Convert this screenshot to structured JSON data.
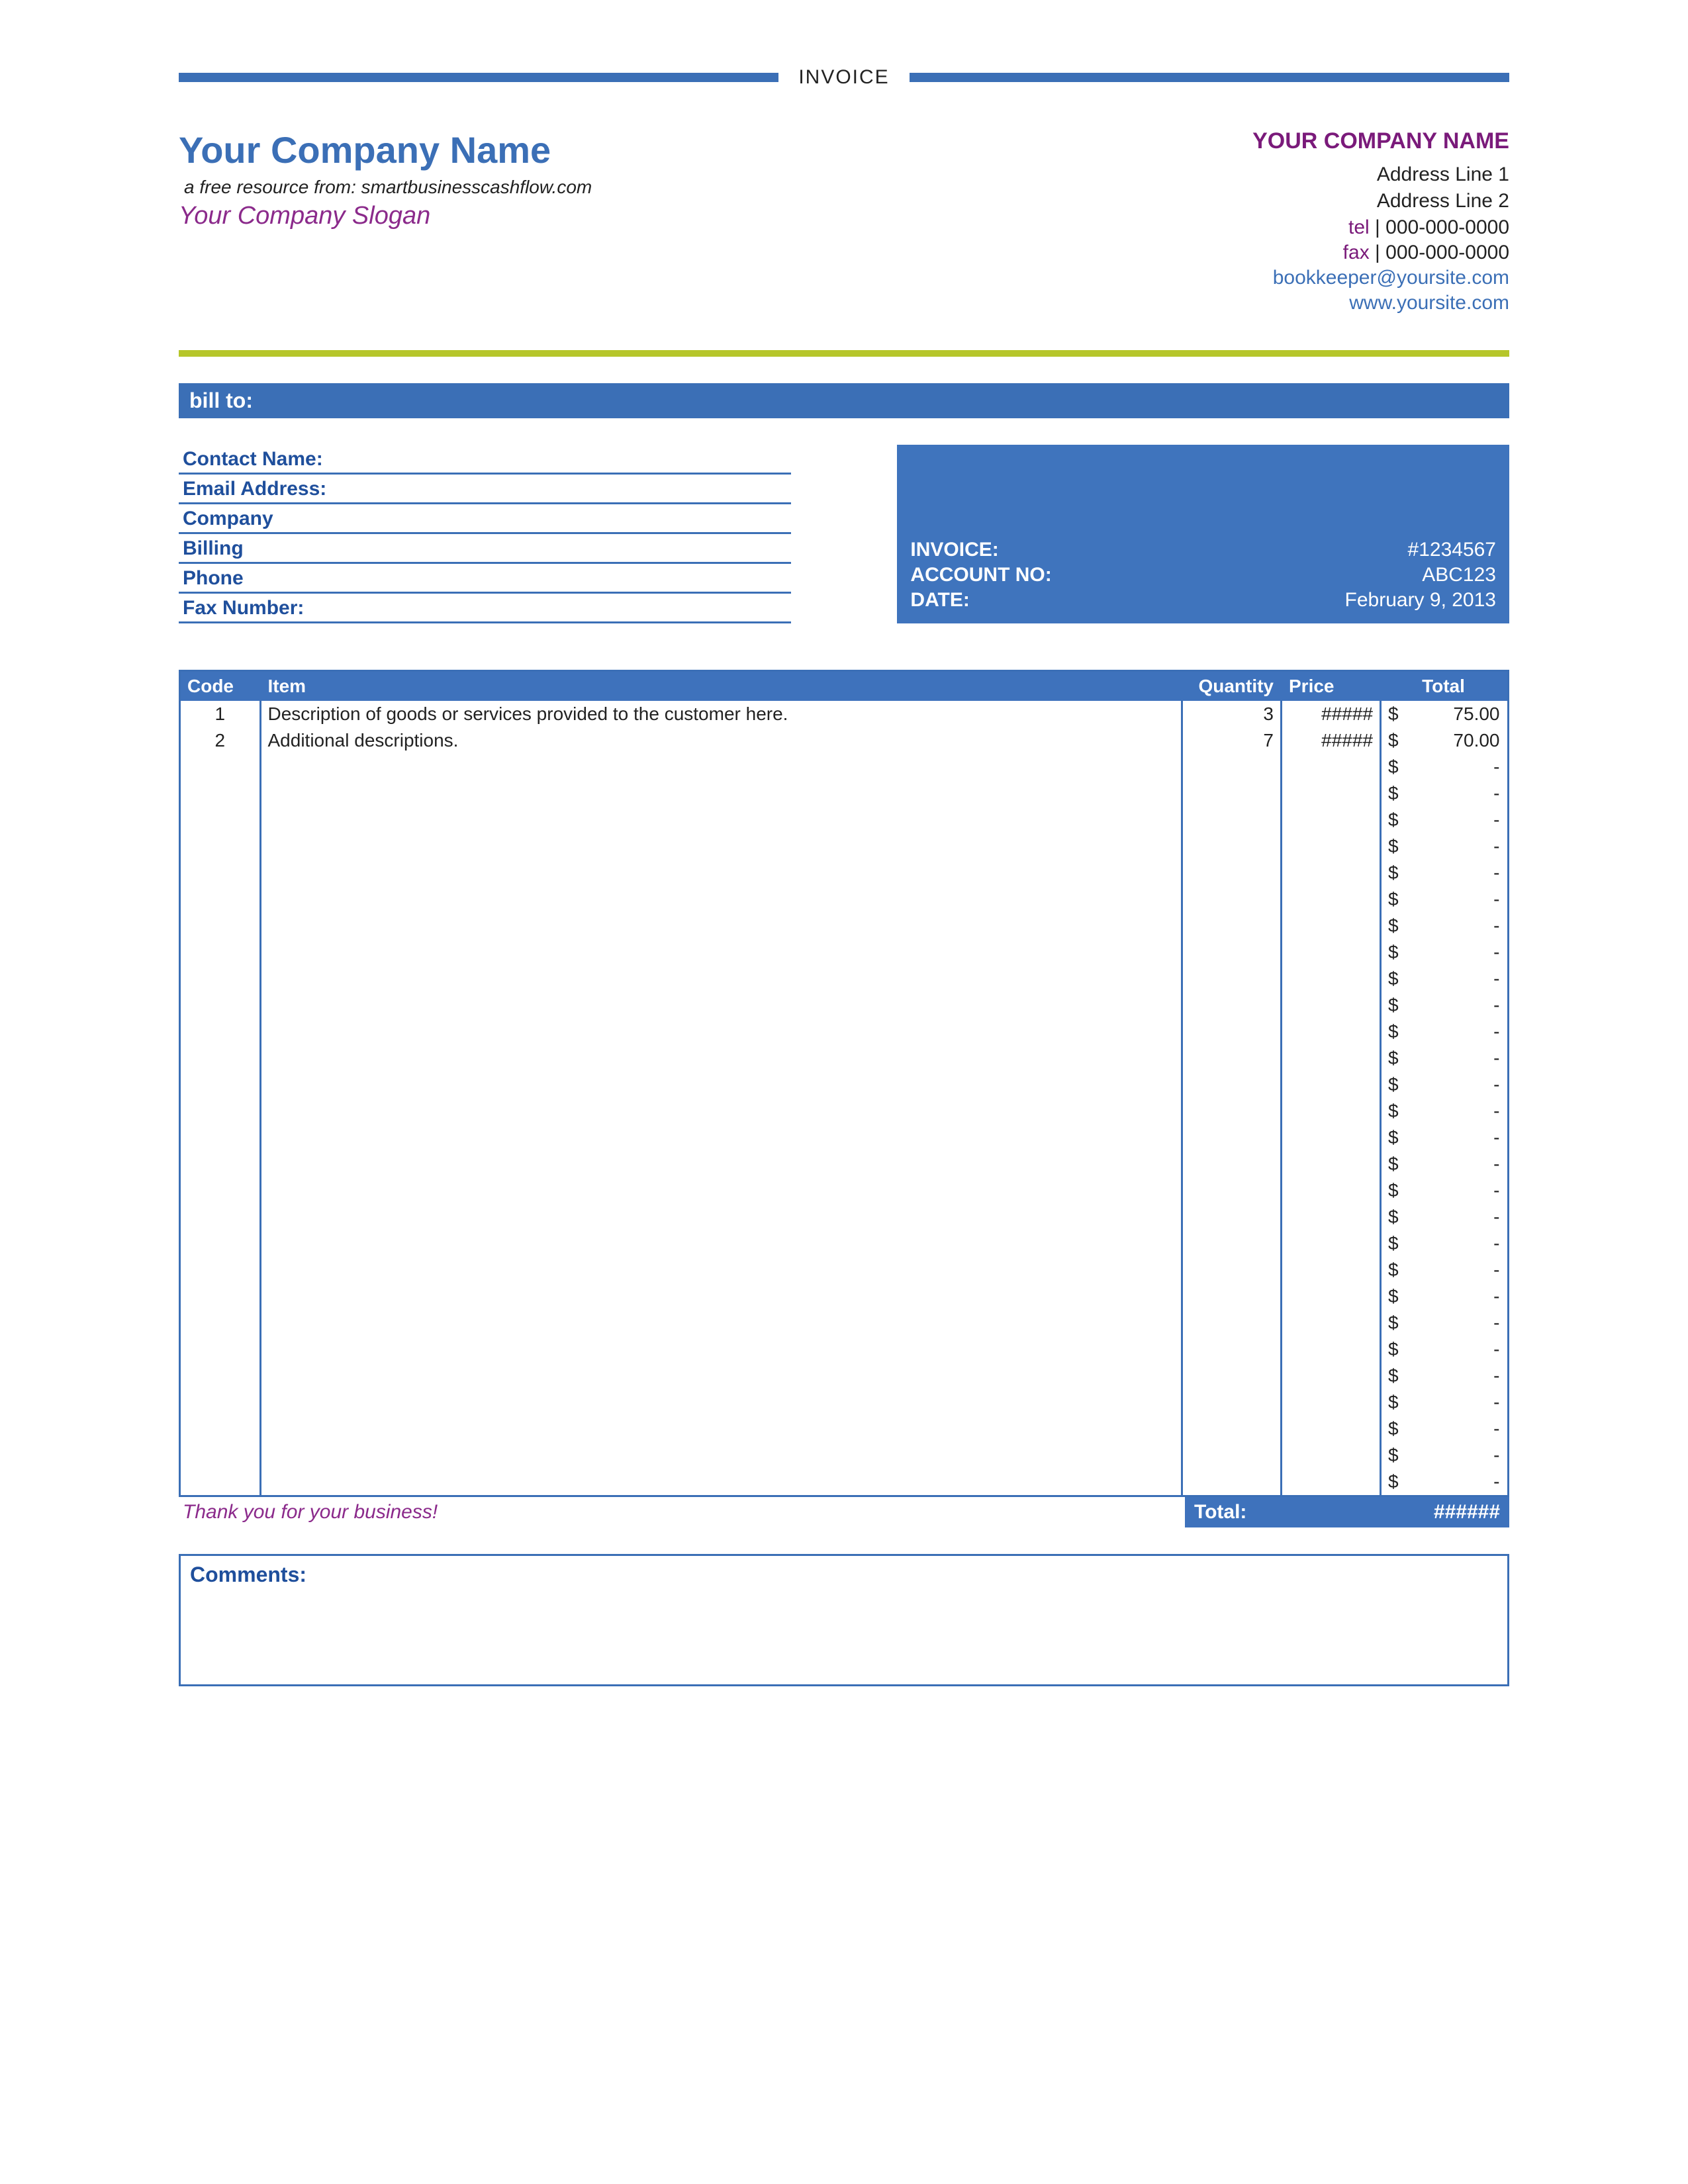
{
  "top_label": "INVOICE",
  "company": {
    "name": "Your Company Name",
    "resource_line": "a free resource from: smartbusinesscashflow.com",
    "slogan": "Your Company Slogan"
  },
  "company_right": {
    "name": "YOUR COMPANY NAME",
    "address1": "Address Line 1",
    "address2": "Address Line 2",
    "tel_label": "tel",
    "tel": "000-000-0000",
    "fax_label": "fax",
    "fax": "000-000-0000",
    "email": "bookkeeper@yoursite.com",
    "website": "www.yoursite.com",
    "separator": " | "
  },
  "billto": {
    "bar_label": "bill to:",
    "fields": {
      "contact": "Contact Name:",
      "email": "Email Address:",
      "company": "Company",
      "billing": "Billing",
      "phone": "Phone",
      "fax": "Fax Number:"
    }
  },
  "meta": {
    "invoice_label": "INVOICE:",
    "invoice_value": "#1234567",
    "account_label": "ACCOUNT NO:",
    "account_value": "ABC123",
    "date_label": "DATE:",
    "date_value": "February 9, 2013"
  },
  "columns": {
    "code": "Code",
    "item": "Item",
    "qty": "Quantity",
    "price": "Price",
    "total": "Total"
  },
  "currency": "$",
  "empty_amount": "-",
  "price_overflow": "#####",
  "lines": [
    {
      "code": "1",
      "item": "Description of goods or services provided to the customer here.",
      "qty": "3",
      "price": "#####",
      "total": "75.00"
    },
    {
      "code": "2",
      "item": "Additional descriptions.",
      "qty": "7",
      "price": "#####",
      "total": "70.00"
    },
    {
      "code": "",
      "item": "",
      "qty": "",
      "price": "",
      "total": "-"
    },
    {
      "code": "",
      "item": "",
      "qty": "",
      "price": "",
      "total": "-"
    },
    {
      "code": "",
      "item": "",
      "qty": "",
      "price": "",
      "total": "-"
    },
    {
      "code": "",
      "item": "",
      "qty": "",
      "price": "",
      "total": "-"
    },
    {
      "code": "",
      "item": "",
      "qty": "",
      "price": "",
      "total": "-"
    },
    {
      "code": "",
      "item": "",
      "qty": "",
      "price": "",
      "total": "-"
    },
    {
      "code": "",
      "item": "",
      "qty": "",
      "price": "",
      "total": "-"
    },
    {
      "code": "",
      "item": "",
      "qty": "",
      "price": "",
      "total": "-"
    },
    {
      "code": "",
      "item": "",
      "qty": "",
      "price": "",
      "total": "-"
    },
    {
      "code": "",
      "item": "",
      "qty": "",
      "price": "",
      "total": "-"
    },
    {
      "code": "",
      "item": "",
      "qty": "",
      "price": "",
      "total": "-"
    },
    {
      "code": "",
      "item": "",
      "qty": "",
      "price": "",
      "total": "-"
    },
    {
      "code": "",
      "item": "",
      "qty": "",
      "price": "",
      "total": "-"
    },
    {
      "code": "",
      "item": "",
      "qty": "",
      "price": "",
      "total": "-"
    },
    {
      "code": "",
      "item": "",
      "qty": "",
      "price": "",
      "total": "-"
    },
    {
      "code": "",
      "item": "",
      "qty": "",
      "price": "",
      "total": "-"
    },
    {
      "code": "",
      "item": "",
      "qty": "",
      "price": "",
      "total": "-"
    },
    {
      "code": "",
      "item": "",
      "qty": "",
      "price": "",
      "total": "-"
    },
    {
      "code": "",
      "item": "",
      "qty": "",
      "price": "",
      "total": "-"
    },
    {
      "code": "",
      "item": "",
      "qty": "",
      "price": "",
      "total": "-"
    },
    {
      "code": "",
      "item": "",
      "qty": "",
      "price": "",
      "total": "-"
    },
    {
      "code": "",
      "item": "",
      "qty": "",
      "price": "",
      "total": "-"
    },
    {
      "code": "",
      "item": "",
      "qty": "",
      "price": "",
      "total": "-"
    },
    {
      "code": "",
      "item": "",
      "qty": "",
      "price": "",
      "total": "-"
    },
    {
      "code": "",
      "item": "",
      "qty": "",
      "price": "",
      "total": "-"
    },
    {
      "code": "",
      "item": "",
      "qty": "",
      "price": "",
      "total": "-"
    },
    {
      "code": "",
      "item": "",
      "qty": "",
      "price": "",
      "total": "-"
    },
    {
      "code": "",
      "item": "",
      "qty": "",
      "price": "",
      "total": "-"
    }
  ],
  "thanks": "Thank you for your business!",
  "grand_total_label": "Total:",
  "grand_total_value": "######",
  "comments_label": "Comments:"
}
